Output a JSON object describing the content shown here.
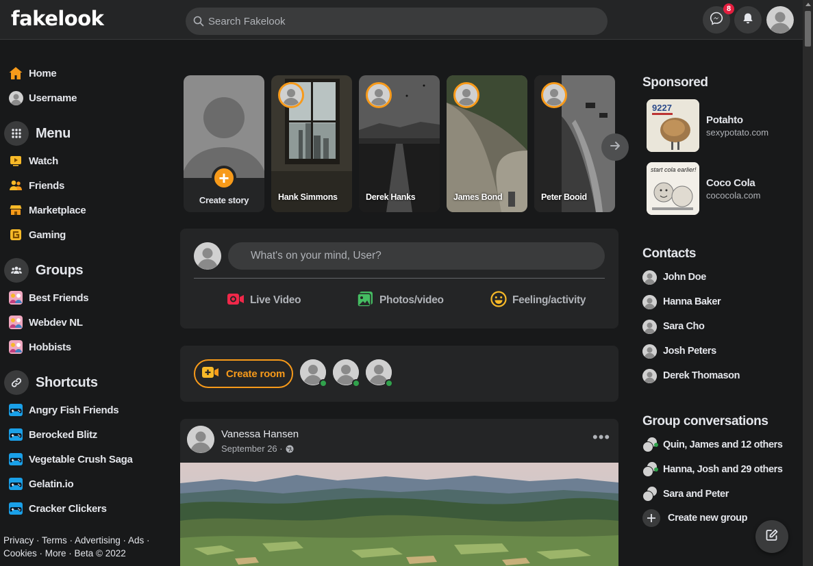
{
  "header": {
    "logo": "fakelook",
    "search_placeholder": "Search Fakelook",
    "messenger_badge": "8"
  },
  "left": {
    "home": "Home",
    "username": "Username",
    "menu_title": "Menu",
    "menu_items": [
      "Watch",
      "Friends",
      "Marketplace",
      "Gaming"
    ],
    "groups_title": "Groups",
    "groups": [
      "Best Friends",
      "Webdev NL",
      "Hobbists"
    ],
    "shortcuts_title": "Shortcuts",
    "shortcuts": [
      "Angry Fish Friends",
      "Berocked Blitz",
      "Vegetable Crush Saga",
      "Gelatin.io",
      "Cracker Clickers"
    ],
    "footer_line1": "Privacy · Terms · Advertising · Ads ·",
    "footer_line2": "Cookies · More · Beta © 2022"
  },
  "stories": {
    "create_label": "Create story",
    "items": [
      "Hank Simmons",
      "Derek Hanks",
      "James Bond",
      "Peter Booid"
    ]
  },
  "composer": {
    "placeholder": "What's on your mind, User?",
    "actions": [
      "Live Video",
      "Photos/video",
      "Feeling/activity"
    ]
  },
  "room": {
    "button_label": "Create room"
  },
  "post": {
    "author": "Vanessa Hansen",
    "date": "September 26 ·"
  },
  "right": {
    "sponsored_title": "Sponsored",
    "ads": [
      {
        "name": "Potahto",
        "url": "sexypotato.com",
        "img_text": "9227"
      },
      {
        "name": "Coco Cola",
        "url": "cococola.com",
        "img_text": "start cola earlier!"
      }
    ],
    "contacts_title": "Contacts",
    "contacts": [
      "John Doe",
      "Hanna Baker",
      "Sara Cho",
      "Josh Peters",
      "Derek Thomason"
    ],
    "group_conv_title": "Group conversations",
    "group_convs": [
      "Quin, James and 12 others",
      "Hanna, Josh and 29 others",
      "Sara and Peter"
    ],
    "create_group": "Create new group"
  },
  "colors": {
    "accent": "#f79a1a",
    "background": "#18191a",
    "card": "#242526",
    "online": "#31a24c",
    "badge": "#e41e3f"
  }
}
